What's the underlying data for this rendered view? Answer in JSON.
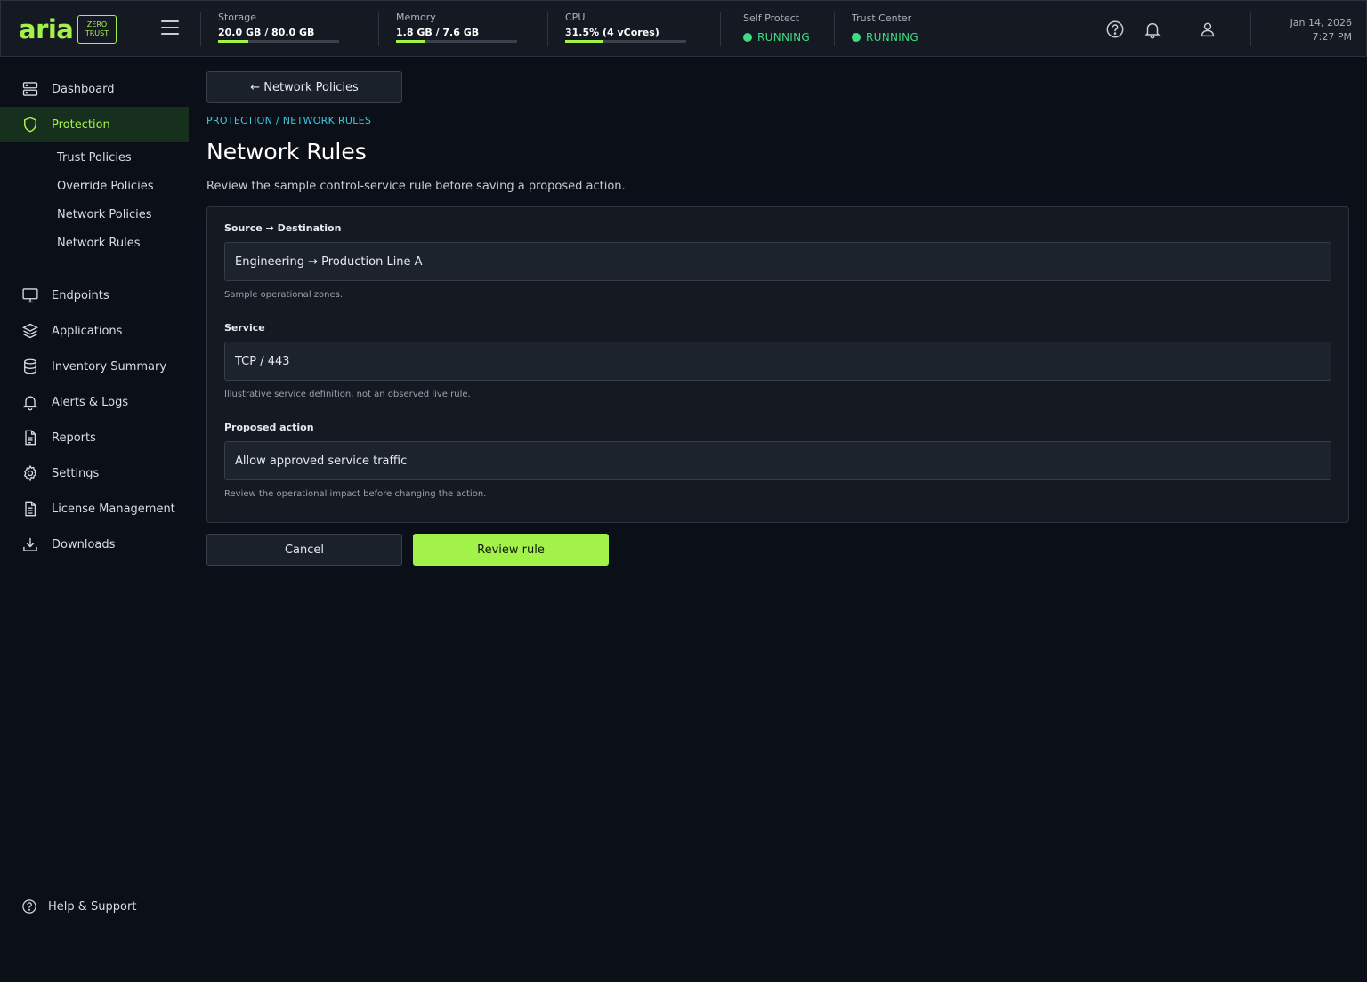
{
  "brand": {
    "name": "aria",
    "badge_line1": "ZERO",
    "badge_line2": "TRUST"
  },
  "topbar": {
    "storage": {
      "label": "Storage",
      "value": "20.0 GB / 80.0 GB",
      "fraction": 0.25
    },
    "memory": {
      "label": "Memory",
      "value": "1.8 GB / 7.6 GB",
      "fraction": 0.24
    },
    "cpu": {
      "label": "CPU",
      "value": "31.5% (4 vCores)",
      "fraction": 0.315
    },
    "self_protect": {
      "label": "Self Protect",
      "value": "RUNNING"
    },
    "trust_center": {
      "label": "Trust Center",
      "value": "RUNNING"
    },
    "date": "Jan 14, 2026",
    "time": "7:27 PM"
  },
  "sidebar": {
    "items": [
      {
        "label": "Dashboard",
        "icon": "server-icon"
      },
      {
        "label": "Protection",
        "icon": "shield-icon"
      },
      {
        "label": "Endpoints",
        "icon": "monitor-icon"
      },
      {
        "label": "Applications",
        "icon": "layers-icon"
      },
      {
        "label": "Inventory Summary",
        "icon": "database-icon"
      },
      {
        "label": "Alerts & Logs",
        "icon": "bell-icon"
      },
      {
        "label": "Reports",
        "icon": "document-icon"
      },
      {
        "label": "Settings",
        "icon": "gear-icon"
      },
      {
        "label": "License Management",
        "icon": "license-icon"
      },
      {
        "label": "Downloads",
        "icon": "download-icon"
      }
    ],
    "sub_items": [
      "Trust Policies",
      "Override Policies",
      "Network Policies",
      "Network Rules"
    ],
    "help": "Help & Support"
  },
  "main": {
    "back_label": "← Network Policies",
    "breadcrumb": "PROTECTION / NETWORK RULES",
    "title": "Network Rules",
    "description": "Review the sample control-service rule before saving a proposed action.",
    "fields": [
      {
        "label": "Source → Destination",
        "value": "Engineering → Production Line A",
        "help": "Sample operational zones."
      },
      {
        "label": "Service",
        "value": "TCP / 443",
        "help": "Illustrative service definition, not an observed live rule."
      },
      {
        "label": "Proposed action",
        "value": "Allow approved service traffic",
        "help": "Review the operational impact before changing the action."
      }
    ],
    "cancel_label": "Cancel",
    "submit_label": "Review rule"
  },
  "colors": {
    "accent": "#a3f24a",
    "running": "#3ddc84",
    "breadcrumb": "#3fc7e0",
    "background": "#0b0f17"
  }
}
